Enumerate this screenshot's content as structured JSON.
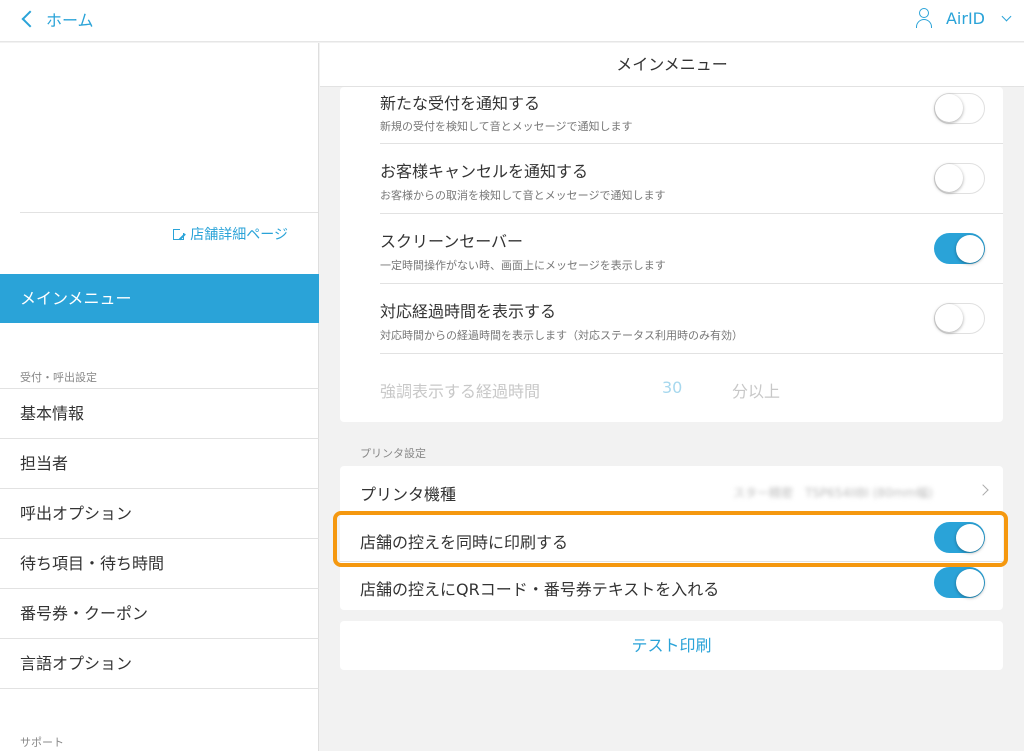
{
  "header": {
    "back_label": "ホーム",
    "account_label": "AirID"
  },
  "sidebar": {
    "store_link": "店舗詳細ページ",
    "active_item": "メインメニュー",
    "section_reception": "受付・呼出設定",
    "items": [
      {
        "label": "基本情報"
      },
      {
        "label": "担当者"
      },
      {
        "label": "呼出オプション"
      },
      {
        "label": "待ち項目・待ち時間"
      },
      {
        "label": "番号券・クーポン"
      },
      {
        "label": "言語オプション"
      }
    ],
    "section_support": "サポート"
  },
  "main": {
    "title": "メインメニュー",
    "settings": [
      {
        "title": "新たな受付を通知する",
        "subtitle": "新規の受付を検知して音とメッセージで通知します",
        "toggle": "off"
      },
      {
        "title": "お客様キャンセルを通知する",
        "subtitle": "お客様からの取消を検知して音とメッセージで通知します",
        "toggle": "off"
      },
      {
        "title": "スクリーンセーバー",
        "subtitle": "一定時間操作がない時、画面上にメッセージを表示します",
        "toggle": "on"
      },
      {
        "title": "対応経過時間を表示する",
        "subtitle": "対応時間からの経過時間を表示します（対応ステータス利用時のみ有効）",
        "toggle": "off"
      }
    ],
    "elapsed": {
      "label": "強調表示する経過時間",
      "value": "30",
      "unit": "分以上"
    },
    "printer_section": "プリンタ設定",
    "printer_model_label": "プリンタ機種",
    "printer_model_value": "スター精密　TSP654IIBI (80mm幅)",
    "print_store_copy": {
      "label": "店舗の控えを同時に印刷する",
      "toggle": "on"
    },
    "print_qr": {
      "label": "店舗の控えにQRコード・番号券テキストを入れる",
      "toggle": "on"
    },
    "test_print": "テスト印刷"
  },
  "colors": {
    "accent": "#2aa3d8",
    "highlight": "#f5980f"
  }
}
